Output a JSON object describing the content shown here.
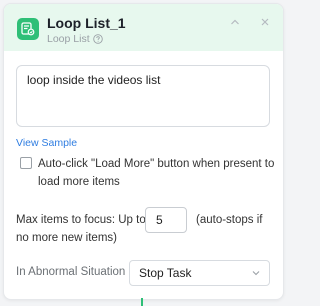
{
  "header": {
    "title": "Loop List_1",
    "subtitle": "Loop List",
    "icon": "loop-list-icon",
    "accent_color": "#2fbf77",
    "background_color": "#e7f8ee"
  },
  "description": {
    "value": "loop inside the videos list"
  },
  "view_sample": {
    "label": "View Sample",
    "color": "#2f7de1"
  },
  "auto_click": {
    "label": "Auto-click \"Load More\" button when present to load more items",
    "checked": false
  },
  "max_items": {
    "label": "Max items to focus: Up to",
    "value": "5",
    "note_line1": "(auto-stops if",
    "note_line2": "no more new items)"
  },
  "abnormal": {
    "label": "In Abnormal Situation",
    "selected": "Stop Task"
  }
}
